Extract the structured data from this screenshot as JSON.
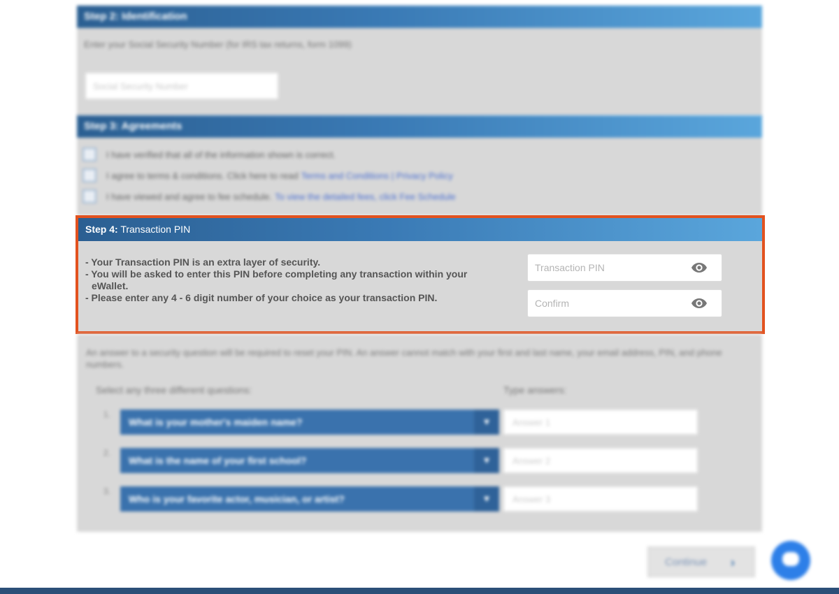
{
  "step2": {
    "title": "Step 2: Identification",
    "hint": "Enter your Social Security Number (for IRS tax returns, form 1099)",
    "ssn_placeholder": "Social Security Number"
  },
  "step3": {
    "title": "Step 3: Agreements",
    "items": [
      {
        "text": "I have verified that all of the information shown is correct.",
        "link": ""
      },
      {
        "text": "I agree to terms & conditions. Click here to read",
        "link": "Terms and Conditions | Privacy Policy"
      },
      {
        "text": "I have viewed and agree to fee schedule.",
        "link": "To view the detailed fees, click Fee Schedule"
      }
    ]
  },
  "step4": {
    "title_prefix": "Step 4:",
    "title": "Transaction PIN",
    "info": [
      "- Your Transaction PIN is an extra layer of security.",
      "- You will be asked to enter this PIN before completing any transaction within your eWallet.",
      "- Please enter any 4 - 6 digit number of your choice as your transaction PIN."
    ],
    "pin_placeholder": "Transaction PIN",
    "confirm_placeholder": "Confirm"
  },
  "security": {
    "intro": "An answer to a security question will be required to reset your PIN. An answer cannot match with your first and last name, your email address, PIN, and phone numbers.",
    "questions_label": "Select any three different questions:",
    "answers_label": "Type answers:",
    "rows": [
      {
        "num": "1.",
        "question": "What is your mother's maiden name?",
        "answer_placeholder": "Answer 1"
      },
      {
        "num": "2.",
        "question": "What is the name of your first school?",
        "answer_placeholder": "Answer 2"
      },
      {
        "num": "3.",
        "question": "Who is your favorite actor, musician, or artist?",
        "answer_placeholder": "Answer 3"
      }
    ]
  },
  "continue_label": "Continue",
  "icons": {
    "password_toggle": "eye-icon",
    "chat": "chat-bubble-icon",
    "dropdown": "caret-down-icon"
  },
  "colors": {
    "header_gradient_start": "#2b5f92",
    "header_gradient_end": "#5aa6dc",
    "highlight": "#e2521f",
    "panel": "#d8d8d8"
  }
}
